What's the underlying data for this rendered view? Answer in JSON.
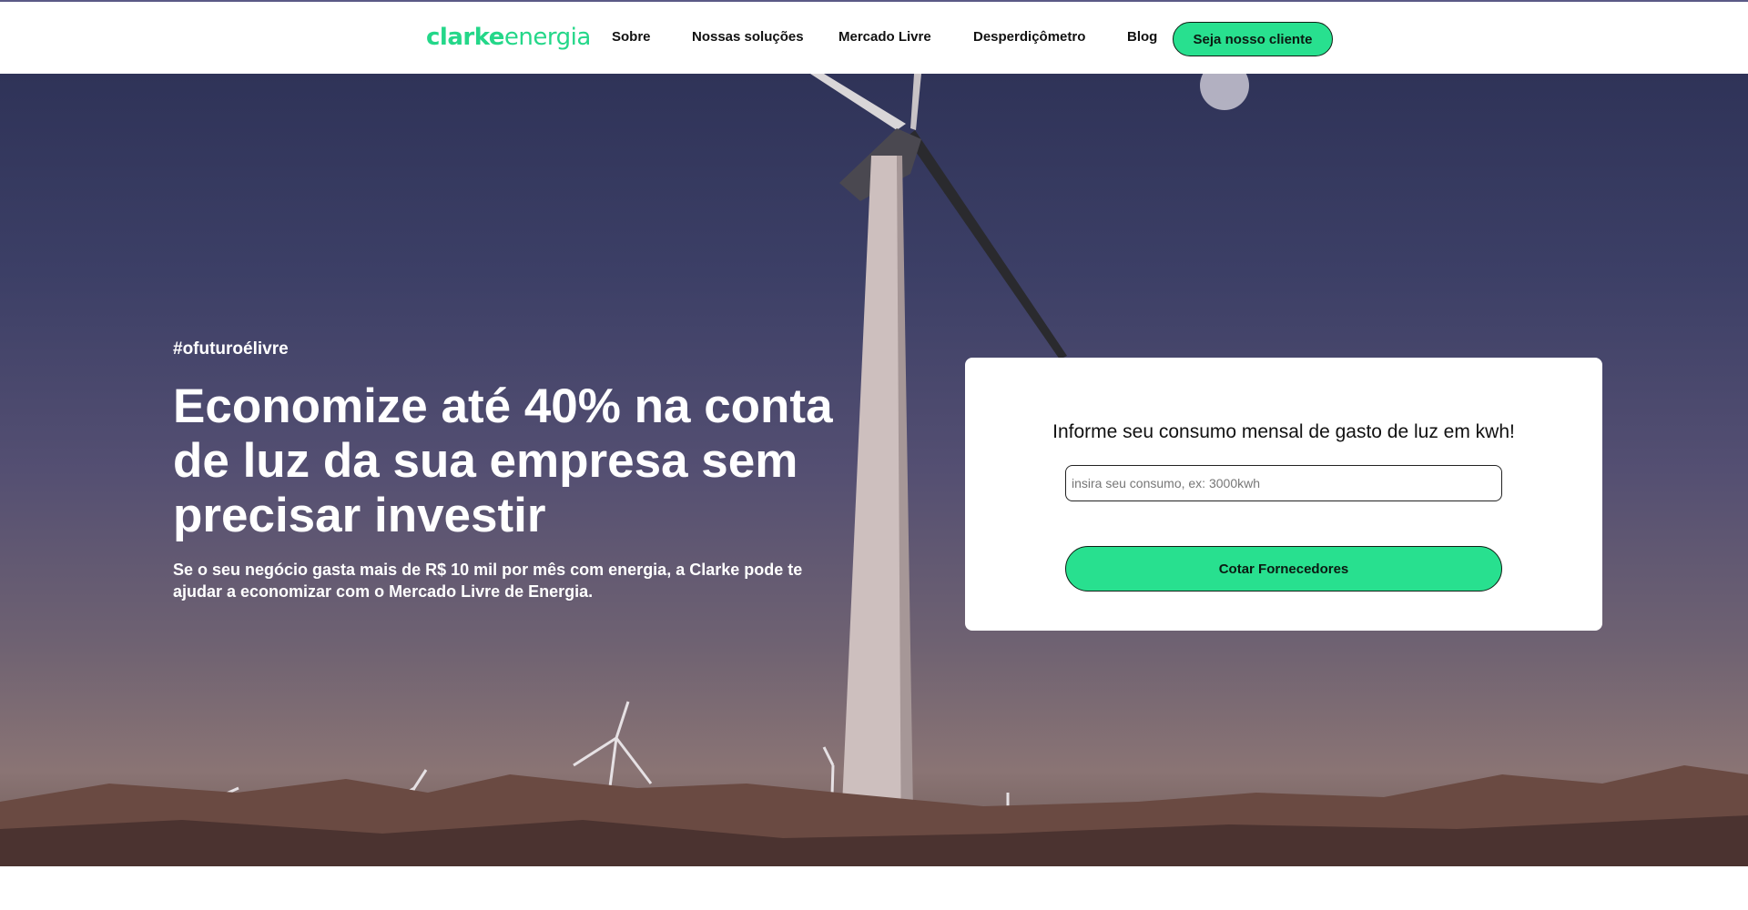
{
  "header": {
    "logo": {
      "part1": "clarke",
      "part2": "energia"
    },
    "nav": [
      {
        "label": "Sobre"
      },
      {
        "label": "Nossas soluções"
      },
      {
        "label": "Mercado Livre"
      },
      {
        "label": "Desperdiçômetro"
      },
      {
        "label": "Blog"
      }
    ],
    "cta_label": "Seja nosso cliente"
  },
  "hero": {
    "hashtag": "#ofuturoélivre",
    "headline": "Economize até 40% na conta de luz da sua empresa sem precisar investir",
    "subtext": "Se o seu negócio gasta mais de R$ 10 mil por mês com energia, a Clarke pode te ajudar a economizar com o Mercado Livre de Energia.",
    "form": {
      "title": "Informe seu consumo mensal de gasto de luz em kwh!",
      "input_placeholder": "insira seu consumo, ex: 3000kwh",
      "button_label": "Cotar Fornecedores"
    }
  },
  "colors": {
    "accent": "#28e08f",
    "logo": "#24d789",
    "header_border": "#5b5a86"
  }
}
